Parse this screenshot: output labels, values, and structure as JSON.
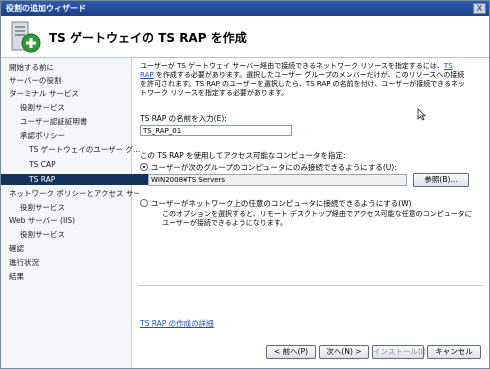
{
  "window": {
    "title": "役割の追加ウィザード",
    "close": "X"
  },
  "header": {
    "title": "TS ゲートウェイの TS RAP を作成"
  },
  "nav": [
    "開始する前に",
    "サーバーの役割",
    "ターミナル サービス",
    "役割サービス",
    "ユーザー認証証明書",
    "承認ポリシー",
    "TS ゲートウェイのユーザー グ...",
    "TS CAP",
    "TS RAP",
    "ネットワーク ポリシーとアクセス サービ...",
    "役割サービス",
    "Web サーバー (IIS)",
    "役割サービス",
    "確認",
    "進行状況",
    "結果"
  ],
  "main": {
    "description_text": "ユーザーが TS ゲートウェイ サーバー経由で接続できるネットワーク リソースを指定するには、",
    "description_link": "TS RAP",
    "description_rest": " を作成する必要があります。選択したユーザー グループのメンバーだけが、このリソースへの接続を許可されます。TS RAP のユーザーを選択したら、TS RAP の名前を付け、ユーザーが接続できるネットワーク リソースを指定する必要があります。",
    "name_label": "TS RAP の名前を入力(E):",
    "name_value": "TS_RAP_01",
    "group_label": "この TS RAP を使用してアクセス可能なコンピュータを指定:",
    "option1": "ユーザーが次のグループのコンピュータにのみ接続できるようにする(U):",
    "group_value": "WIN2008¥TS Servers",
    "browse": "参照(B)...",
    "option2": "ユーザーがネットワーク上の任意のコンピュータに接続できるようにする(W)",
    "option2_note": "このオプションを選択すると、リモート デスクトップ経由でアクセス可能な任意のコンピュータにユーザーが接続できるようになります。",
    "more_link": "TS RAP の作成の詳細"
  },
  "buttons": {
    "back": "< 前へ(P)",
    "next": "次へ(N) >",
    "install": "インストール(I)",
    "cancel": "キャンセル"
  }
}
